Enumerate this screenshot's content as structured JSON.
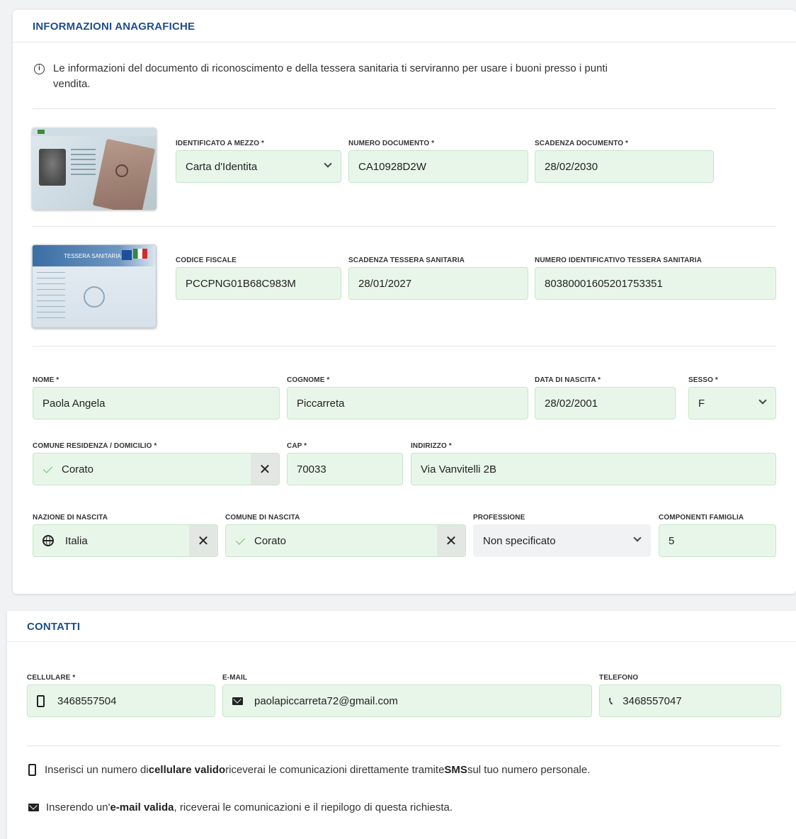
{
  "anagrafica": {
    "title": "INFORMAZIONI ANAGRAFICHE",
    "info_text_line1": "Le informazioni del documento di riconoscimento e della tessera sanitaria ti serviranno per usare i buoni presso i punti",
    "info_text_line2": "vendita.",
    "identificato_label": "IDENTIFICATO A MEZZO *",
    "identificato_value": "Carta d'Identita",
    "numero_documento_label": "NUMERO DOCUMENTO *",
    "numero_documento_value": "CA10928D2W",
    "scadenza_documento_label": "SCADENZA DOCUMENTO *",
    "scadenza_documento_value": "28/02/2030",
    "codice_fiscale_label": "CODICE FISCALE",
    "codice_fiscale_value": "PCCPNG01B68C983M",
    "scadenza_tessera_label": "SCADENZA TESSERA SANITARIA",
    "scadenza_tessera_value": "28/01/2027",
    "numero_tessera_label": "NUMERO IDENTIFICATIVO TESSERA SANITARIA",
    "numero_tessera_value": "80380001605201753351",
    "tessera_card_text": "TESSERA SANITARIA",
    "nome_label": "NOME *",
    "nome_value": "Paola Angela",
    "cognome_label": "COGNOME *",
    "cognome_value": "Piccarreta",
    "data_nascita_label": "DATA DI NASCITA *",
    "data_nascita_value": "28/02/2001",
    "sesso_label": "SESSO *",
    "sesso_value": "F",
    "comune_residenza_label": "COMUNE RESIDENZA / DOMICILIO *",
    "comune_residenza_value": "Corato",
    "cap_label": "CAP *",
    "cap_value": "70033",
    "indirizzo_label": "INDIRIZZO *",
    "indirizzo_value": "Via Vanvitelli 2B",
    "nazione_nascita_label": "NAZIONE DI NASCITA",
    "nazione_nascita_value": "Italia",
    "comune_nascita_label": "COMUNE DI NASCITA",
    "comune_nascita_value": "Corato",
    "professione_label": "PROFESSIONE",
    "professione_value": "Non specificato",
    "componenti_label": "COMPONENTI FAMIGLIA",
    "componenti_value": "5",
    "clear_symbol": "✕"
  },
  "contatti": {
    "title": "CONTATTI",
    "cellulare_label": "CELLULARE *",
    "cellulare_value": "3468557504",
    "email_label": "E-MAIL",
    "email_value": "paolapiccarreta72@gmail.com",
    "telefono_label": "TELEFONO",
    "telefono_value": "3468557047",
    "note1_pre": "Inserisci un numero di ",
    "note1_bold1": "cellulare valido",
    "note1_mid": " riceverai le comunicazioni direttamente tramite ",
    "note1_bold2": "SMS",
    "note1_post": " sul tuo numero personale.",
    "note2_pre": "Inserendo un'",
    "note2_bold": "e-mail valida",
    "note2_post": ", riceverai le comunicazioni e il riepilogo di questa richiesta."
  },
  "icons": {
    "info": "info-icon",
    "check": "check-icon",
    "globe": "globe-icon",
    "mobile": "mobile-phone-icon",
    "mail": "envelope-icon",
    "telephone": "telephone-icon",
    "clear": "close-icon",
    "dropdown": "chevron-down-icon"
  },
  "colors": {
    "accent": "#1f4e8c",
    "field_bg": "#e8f6e9",
    "field_border": "#c6e6c9",
    "valid_check": "#6cbf73"
  }
}
